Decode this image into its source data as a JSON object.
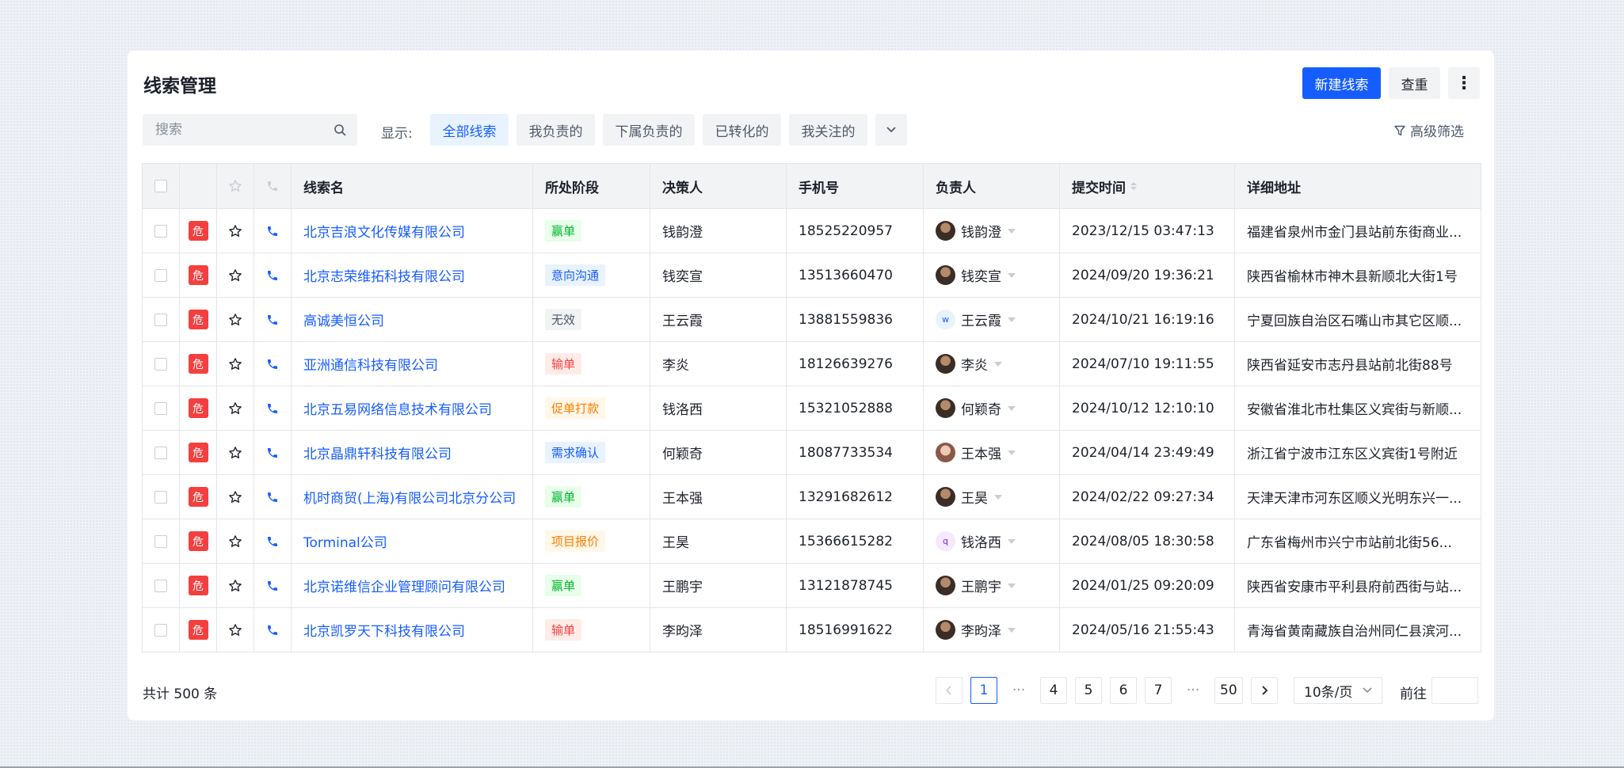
{
  "page": {
    "title": "线索管理",
    "new_button": "新建线索",
    "reset_button": "查重",
    "more_button": "⋮"
  },
  "search": {
    "placeholder": "搜索"
  },
  "filters": {
    "label": "显示:",
    "tabs": [
      "全部线索",
      "我负责的",
      "下属负责的",
      "已转化的",
      "我关注的"
    ],
    "active": 0,
    "advanced": "高级筛选"
  },
  "table": {
    "columns": [
      "线索名",
      "所处阶段",
      "决策人",
      "手机号",
      "负责人",
      "提交时间",
      "详细地址"
    ],
    "risk_label": "危",
    "rows": [
      {
        "name": "北京吉浪文化传媒有限公司",
        "stage": "赢单",
        "stage_color": "green",
        "maker": "钱韵澄",
        "mobile": "18525220957",
        "owner": "钱韵澄",
        "avatar": "photo",
        "time": "2023/12/15 03:47:13",
        "addr": "福建省泉州市金门县站前东街商业..."
      },
      {
        "name": "北京志荣维拓科技有限公司",
        "stage": "意向沟通",
        "stage_color": "blue",
        "maker": "钱奕宣",
        "mobile": "13513660470",
        "owner": "钱奕宣",
        "avatar": "photo",
        "time": "2024/09/20 19:36:21",
        "addr": "陕西省榆林市神木县新顺北大街1号"
      },
      {
        "name": "高诚美恒公司",
        "stage": "无效",
        "stage_color": "gray",
        "maker": "王云霞",
        "mobile": "13881559836",
        "owner": "王云霞",
        "avatar": "w",
        "time": "2024/10/21 16:19:16",
        "addr": "宁夏回族自治区石嘴山市其它区顺..."
      },
      {
        "name": "亚洲通信科技有限公司",
        "stage": "输单",
        "stage_color": "red",
        "maker": "李炎",
        "mobile": "18126639276",
        "owner": "李炎",
        "avatar": "photo",
        "time": "2024/07/10 19:11:55",
        "addr": "陕西省延安市志丹县站前北街88号"
      },
      {
        "name": "北京五易网络信息技术有限公司",
        "stage": "促单打款",
        "stage_color": "orange",
        "maker": "钱洛西",
        "mobile": "15321052888",
        "owner": "何颖奇",
        "avatar": "photo",
        "time": "2024/10/12 12:10:10",
        "addr": "安徽省淮北市杜集区义宾街与新顺..."
      },
      {
        "name": "北京晶鼎轩科技有限公司",
        "stage": "需求确认",
        "stage_color": "blue",
        "maker": "何颖奇",
        "mobile": "18087733534",
        "owner": "王本强",
        "avatar": "photo-light",
        "time": "2024/04/14 23:49:49",
        "addr": "浙江省宁波市江东区义宾街1号附近"
      },
      {
        "name": "机时商贸(上海)有限公司北京分公司",
        "stage": "赢单",
        "stage_color": "green",
        "maker": "王本强",
        "mobile": "13291682612",
        "owner": "王昊",
        "avatar": "photo",
        "time": "2024/02/22 09:27:34",
        "addr": "天津天津市河东区顺义光明东兴一..."
      },
      {
        "name": "Torminal公司",
        "stage": "项目报价",
        "stage_color": "orange",
        "maker": "王昊",
        "mobile": "15366615282",
        "owner": "钱洛西",
        "avatar": "q",
        "time": "2024/08/05 18:30:58",
        "addr": "广东省梅州市兴宁市站前北街56..."
      },
      {
        "name": "北京诺维信企业管理顾问有限公司",
        "stage": "赢单",
        "stage_color": "green",
        "maker": "王鹏宇",
        "mobile": "13121878745",
        "owner": "王鹏宇",
        "avatar": "photo",
        "time": "2024/01/25 09:20:09",
        "addr": "陕西省安康市平利县府前西街与站..."
      },
      {
        "name": "北京凯罗天下科技有限公司",
        "stage": "输单",
        "stage_color": "red",
        "maker": "李昀泽",
        "mobile": "18516991622",
        "owner": "李昀泽",
        "avatar": "photo",
        "time": "2024/05/16 21:55:43",
        "addr": "青海省黄南藏族自治州同仁县滨河..."
      }
    ]
  },
  "pagination": {
    "total": "共计 500 条",
    "pages": [
      "1",
      "···",
      "4",
      "5",
      "6",
      "7",
      "···",
      "50"
    ],
    "current": "1",
    "page_size": "10条/页",
    "goto_label": "前往"
  },
  "colors": {
    "primary": "#165dff",
    "danger": "#f53f3f"
  }
}
